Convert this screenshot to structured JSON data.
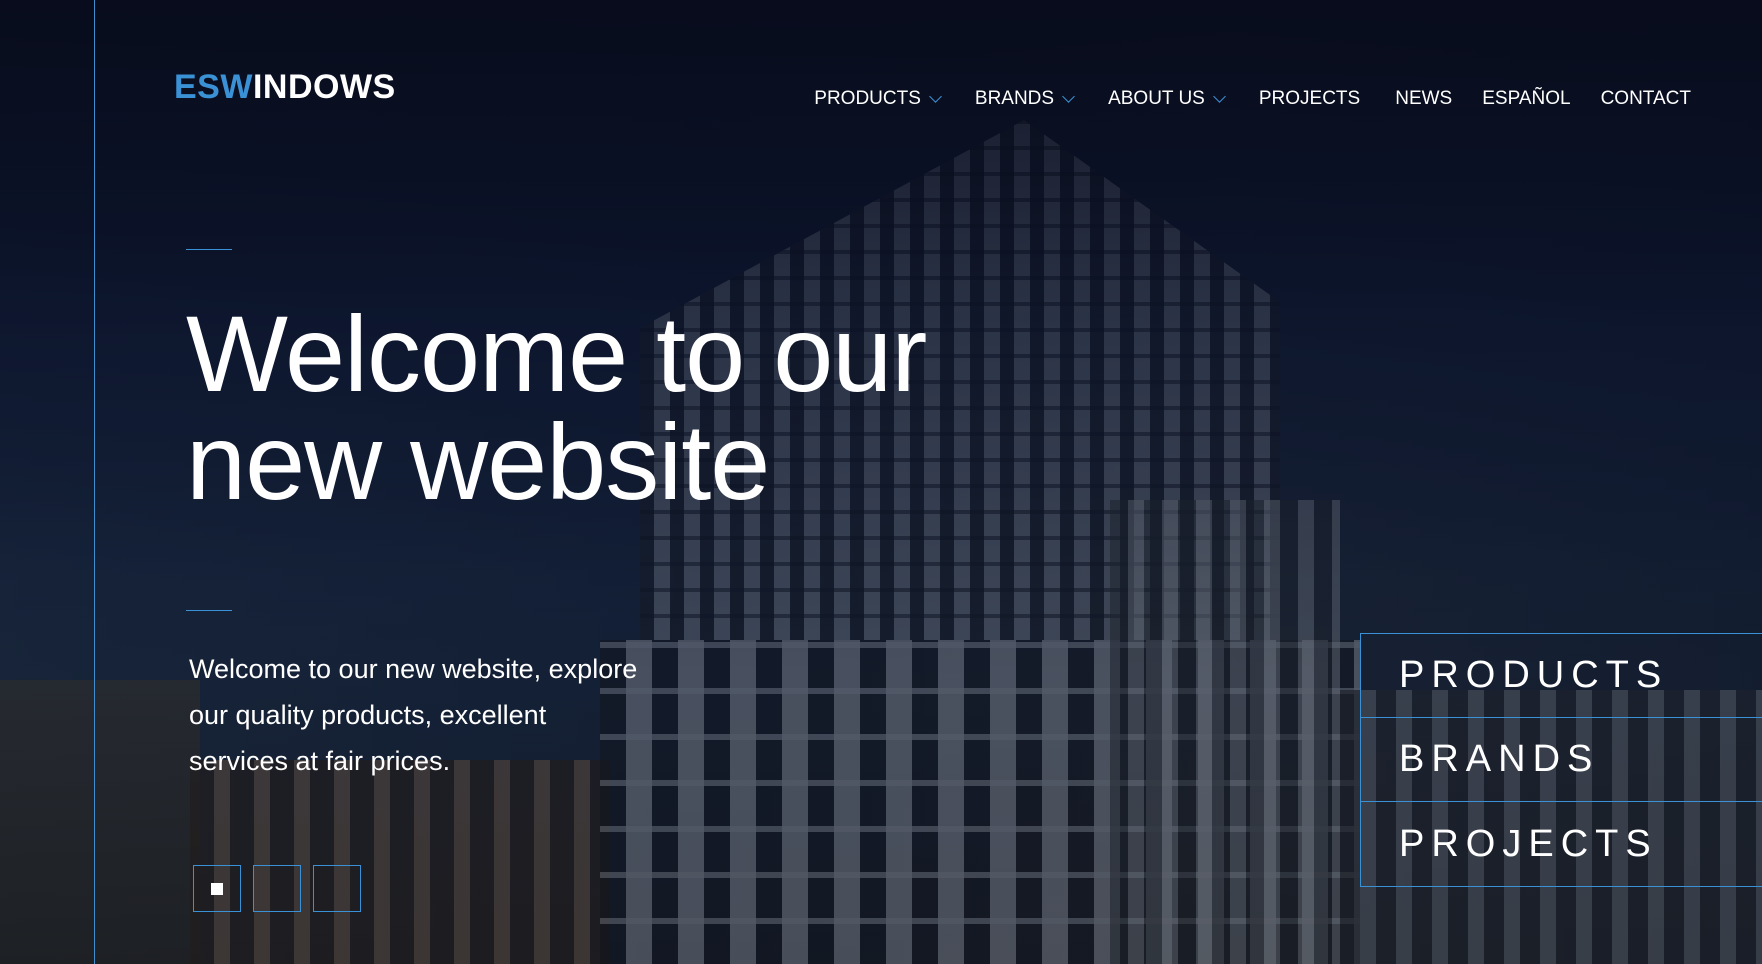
{
  "brand": {
    "logo_accent": "ESW",
    "logo_rest": "INDOWS",
    "accent_color": "#3b91d6"
  },
  "nav": {
    "items": [
      {
        "label": "PRODUCTS",
        "has_dropdown": true
      },
      {
        "label": "BRANDS",
        "has_dropdown": true
      },
      {
        "label": "ABOUT US",
        "has_dropdown": true
      },
      {
        "label": "PROJECTS",
        "has_dropdown": false
      },
      {
        "label": "NEWS",
        "has_dropdown": false
      },
      {
        "label": "ESPAÑOL",
        "has_dropdown": false
      },
      {
        "label": "CONTACT",
        "has_dropdown": false
      }
    ]
  },
  "hero": {
    "headline_line1": "Welcome to our",
    "headline_line2": "new website",
    "subtext_line1": "Welcome to our new website, explore",
    "subtext_line2": "our quality products, excellent",
    "subtext_line3": "services at fair prices.",
    "slides_total": 3,
    "active_slide": 1
  },
  "quick_links": [
    {
      "label": "PRODUCTS"
    },
    {
      "label": "BRANDS"
    },
    {
      "label": "PROJECTS"
    }
  ],
  "icons": {
    "dropdown": "chevron-down-icon"
  }
}
